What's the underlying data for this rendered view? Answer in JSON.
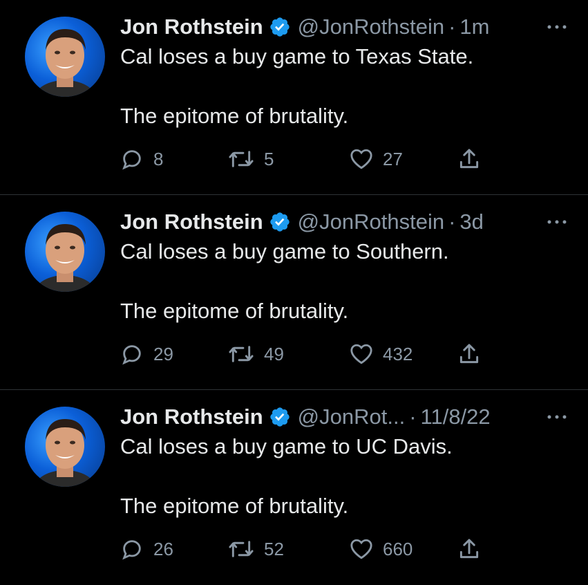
{
  "tweets": [
    {
      "name": "Jon Rothstein",
      "handle": "@JonRothstein",
      "dot": "·",
      "time": "1m",
      "line1": "Cal loses a buy game to Texas State.",
      "line2": "The epitome of brutality.",
      "replies": "8",
      "retweets": "5",
      "likes": "27"
    },
    {
      "name": "Jon Rothstein",
      "handle": "@JonRothstein",
      "dot": "·",
      "time": "3d",
      "line1": "Cal loses a buy game to Southern.",
      "line2": "The epitome of brutality.",
      "replies": "29",
      "retweets": "49",
      "likes": "432"
    },
    {
      "name": "Jon Rothstein",
      "handle": "@JonRot...",
      "dot": "·",
      "time": "11/8/22",
      "line1": "Cal loses a buy game to UC Davis.",
      "line2": "The epitome of brutality.",
      "replies": "26",
      "retweets": "52",
      "likes": "660"
    }
  ],
  "icons": {
    "reply": "reply-icon",
    "retweet": "retweet-icon",
    "like": "heart-icon",
    "share": "share-icon",
    "verified": "verified-badge-icon",
    "more": "more-options-icon"
  },
  "colors": {
    "background": "#000000",
    "text": "#e7e9ea",
    "secondary": "#8b98a5",
    "verified": "#1d9bf0",
    "divider": "#2f3336"
  }
}
